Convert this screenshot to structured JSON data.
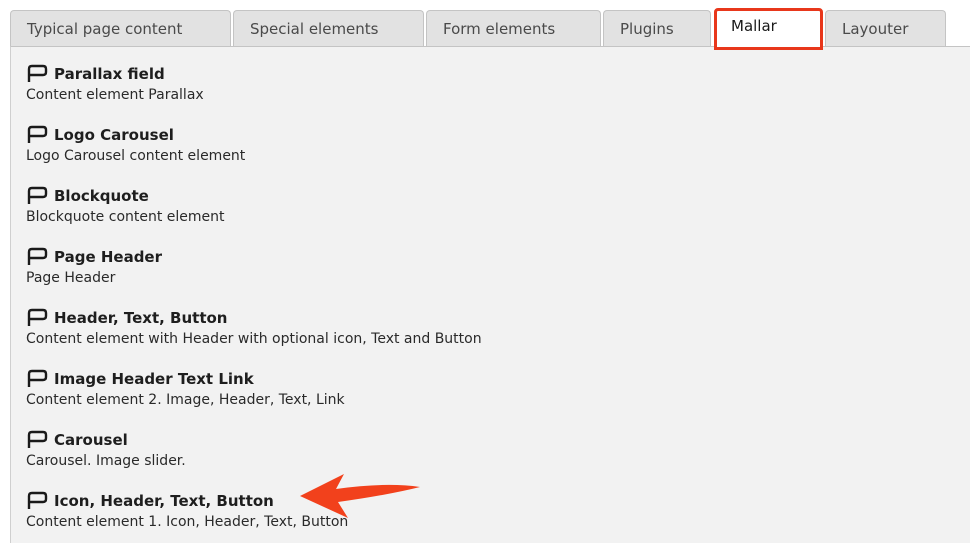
{
  "tabs": [
    {
      "label": "Typical page content",
      "active": false
    },
    {
      "label": "Special elements",
      "active": false
    },
    {
      "label": "Form elements",
      "active": false
    },
    {
      "label": "Plugins",
      "active": false
    },
    {
      "label": "Mallar",
      "active": true
    },
    {
      "label": "Layouter",
      "active": false
    }
  ],
  "items": [
    {
      "title": "Parallax field",
      "description": "Content element Parallax",
      "icon": "content-element-icon"
    },
    {
      "title": "Logo Carousel",
      "description": "Logo Carousel content element",
      "icon": "content-element-icon"
    },
    {
      "title": "Blockquote",
      "description": "Blockquote content element",
      "icon": "content-element-icon"
    },
    {
      "title": "Page Header",
      "description": "Page Header",
      "icon": "content-element-icon"
    },
    {
      "title": "Header, Text, Button",
      "description": "Content element with Header with optional icon, Text and Button",
      "icon": "content-element-icon"
    },
    {
      "title": "Image Header Text Link",
      "description": "Content element 2. Image, Header, Text, Link",
      "icon": "content-element-icon"
    },
    {
      "title": "Carousel",
      "description": "Carousel. Image slider.",
      "icon": "content-element-icon"
    },
    {
      "title": "Icon, Header, Text, Button",
      "description": "Content element 1. Icon, Header, Text, Button",
      "icon": "content-element-icon"
    }
  ],
  "colors": {
    "active_tab_border": "#e8371b",
    "annotation_arrow": "#f2411c",
    "panel_background": "#f2f2f2",
    "tab_background": "#e2e2e2"
  }
}
